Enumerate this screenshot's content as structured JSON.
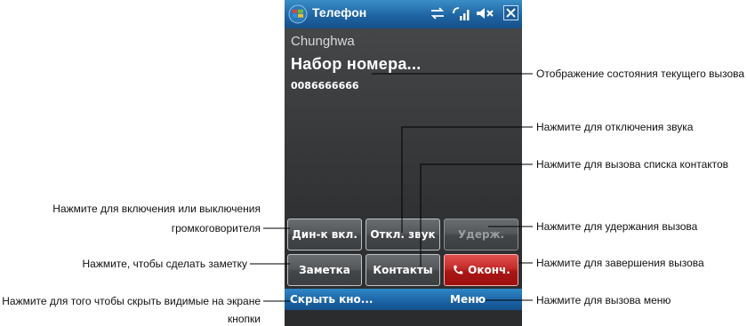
{
  "phone": {
    "title": "Телефон",
    "carrier": "Chunghwa",
    "status": "Набор номера...",
    "number": "0086666666",
    "buttons": {
      "speaker": "Дин-к вкл.",
      "mute": "Откл. звук",
      "hold": "Удерж.",
      "note": "Заметка",
      "contacts": "Контакты",
      "end": "Оконч."
    },
    "softkeys": {
      "left": "Скрыть кно...",
      "right": "Меню"
    }
  },
  "callouts": {
    "status": "Отображение состояния текущего вызова",
    "mute": "Нажмите для отключения звука",
    "contacts": "Нажмите для вызова списка контактов",
    "hold": "Нажмите для удержания вызова",
    "end": "Нажмите для завершения вызова",
    "menu": "Нажмите для вызова меню",
    "speaker_line1": "Нажмите для включения или выключения",
    "speaker_line2": "громкоговорителя",
    "note": "Нажмите, чтобы сделать заметку",
    "hide_line1": "Нажмите для того чтобы скрыть видимые на экране",
    "hide_line2": "кнопки"
  },
  "colors": {
    "title_bar": "#1f64a3",
    "end_button": "#c42a28",
    "screen_bg": "#3a3c3e"
  }
}
